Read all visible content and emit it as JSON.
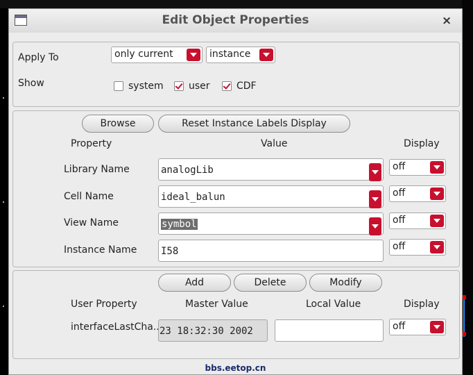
{
  "dialog": {
    "title": "Edit Object Properties",
    "close_symbol": "×"
  },
  "top_panel": {
    "apply_to_label": "Apply To",
    "apply_to_scope": "only current",
    "apply_to_type": "instance",
    "show_label": "Show",
    "show_options": [
      {
        "label": "system",
        "checked": false
      },
      {
        "label": "user",
        "checked": true
      },
      {
        "label": "CDF",
        "checked": true
      }
    ]
  },
  "properties_panel": {
    "browse_label": "Browse",
    "reset_label": "Reset Instance Labels Display",
    "col_property": "Property",
    "col_value": "Value",
    "col_display": "Display",
    "rows": [
      {
        "property": "Library Name",
        "value": "analogLib",
        "display": "off"
      },
      {
        "property": "Cell Name",
        "value": "ideal_balun",
        "display": "off"
      },
      {
        "property": "View Name",
        "value": "symbol",
        "display": "off"
      },
      {
        "property": "Instance Name",
        "value": "I58",
        "display": "off"
      }
    ]
  },
  "user_panel": {
    "add_label": "Add",
    "delete_label": "Delete",
    "modify_label": "Modify",
    "col_user_property": "User Property",
    "col_master_value": "Master Value",
    "col_local_value": "Local Value",
    "col_display": "Display",
    "rows": [
      {
        "property": "interfaceLastCha..",
        "master_value": "23 18:32:30 2002",
        "local_value": "",
        "display": "off"
      }
    ]
  },
  "watermark": "bbs.eetop.cn",
  "colors": {
    "accent": "#c8102e",
    "dialog_bg": "#ececec"
  }
}
